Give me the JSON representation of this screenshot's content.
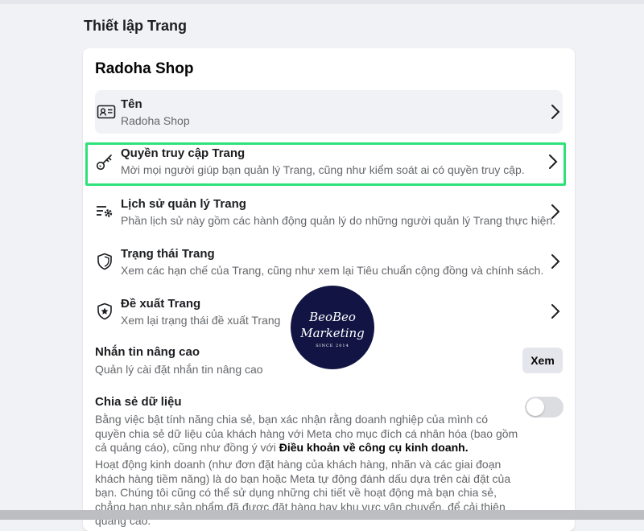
{
  "page": {
    "title": "Thiết lập Trang"
  },
  "card": {
    "title": "Radoha Shop",
    "rows": [
      {
        "label": "Tên",
        "desc": "Radoha Shop",
        "icon": "id-card-icon"
      },
      {
        "label": "Quyền truy cập Trang",
        "desc": "Mời mọi người giúp bạn quản lý Trang, cũng như kiểm soát ai có quyền truy cập.",
        "icon": "key-icon"
      },
      {
        "label": "Lịch sử quản lý Trang",
        "desc": "Phần lịch sử này gồm các hành động quản lý do những người quản lý Trang thực hiện.",
        "icon": "list-gear-icon"
      },
      {
        "label": "Trạng thái Trang",
        "desc": "Xem các hạn chế của Trang, cũng như xem lại Tiêu chuẩn cộng đồng và chính sách.",
        "icon": "shield-icon"
      },
      {
        "label": "Đề xuất Trang",
        "desc": "Xem lại trạng thái đề xuất Trang",
        "icon": "star-shield-icon"
      }
    ],
    "messaging": {
      "label": "Nhắn tin nâng cao",
      "desc": "Quản lý cài đặt nhắn tin nâng cao",
      "button": "Xem"
    },
    "data_sharing": {
      "label": "Chia sẻ dữ liệu",
      "toggle_on": false,
      "p1_before": "Bằng việc bật tính năng chia sẻ, bạn xác nhận rằng doanh nghiệp của mình có quyền chia sẻ dữ liệu của khách hàng với Meta cho mục đích cá nhân hóa (bao gồm cả quảng cáo), cũng như đồng ý với ",
      "p1_link": "Điều khoản về công cụ kinh doanh.",
      "p2": "Hoạt động kinh doanh (như đơn đặt hàng của khách hàng, nhãn và các giai đoạn khách hàng tiềm năng) là do bạn hoặc Meta tự động đánh dấu dựa trên cài đặt của bạn. Chúng tôi cũng có thể sử dụng những chi tiết về hoạt động mà bạn chia sẻ, chẳng hạn như sản phẩm đã được đặt hàng hay khu vực vận chuyển, để cải thiện quảng cáo."
    }
  },
  "watermark": {
    "line1": "BeoBeo",
    "line2": "Marketing",
    "line3": "SINCE 2014"
  },
  "colors": {
    "highlight": "#2ee27a",
    "logo_bg": "#121544"
  }
}
